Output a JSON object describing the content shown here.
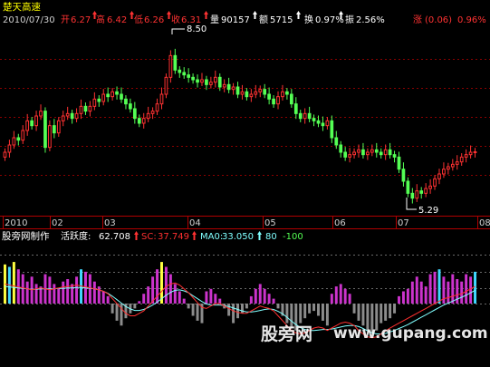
{
  "colors": {
    "background": "#000000",
    "up": "#ff3232",
    "down": "#00e1e1",
    "candle_up": "#ff3232",
    "candle_down": "#54ff54",
    "grid": "#8b0000",
    "axis_text": "#d0d0d0",
    "title": "#ffff00",
    "indicator_up": "#cc33cc",
    "indicator_down": "#8c8c8c",
    "signal_yellow": "#ffff40",
    "signal_cyan": "#40d8ff",
    "sc_line": "#ff3030",
    "ma_line": "#80ffff",
    "ref_line": "#ffffff"
  },
  "header": {
    "stock_name": "楚天高速",
    "date": "2010/07/30",
    "open_label": "开",
    "open_value": "6.27",
    "high_label": "高",
    "high_value": "6.42",
    "low_label": "低",
    "low_value": "6.26",
    "close_label": "收",
    "close_value": "6.31",
    "volume_label": "量",
    "volume_value": "90157",
    "amount_label": "额",
    "amount_value": "5715",
    "turnover_label": "换",
    "turnover_value": "0.97%",
    "amplitude_label": "振",
    "amplitude_value": "2.56%",
    "change_label": "涨",
    "change_value": "(0.06)",
    "change_pct": "0.96%"
  },
  "indicator": {
    "name": "股旁网制作",
    "activity_label": "活跃度:",
    "activity_value": "62.708",
    "sc_label": "SC:",
    "sc_value": "37.749",
    "ma_label": "MA0:",
    "ma_value": "33.050",
    "level_high": "80",
    "level_low": "-100"
  },
  "watermark": {
    "cn": "股旁网",
    "url": "www.gupang.com"
  },
  "chart_data": [
    {
      "type": "candlestick",
      "title": "楚天高速",
      "x_tick_labels": [
        "2010",
        "02",
        "03",
        "04",
        "05",
        "06",
        "07",
        "08"
      ],
      "annotations": [
        {
          "label": "8.50",
          "value": 8.5,
          "note": "period high"
        },
        {
          "label": "5.29",
          "value": 5.29,
          "note": "period low"
        }
      ],
      "ylim": [
        5.1,
        8.7
      ],
      "closes": [
        6.3,
        6.45,
        6.6,
        6.55,
        6.75,
        6.95,
        6.85,
        7.05,
        7.15,
        6.4,
        6.85,
        6.7,
        6.95,
        7.05,
        7.1,
        7.0,
        7.1,
        7.25,
        7.15,
        7.25,
        7.4,
        7.35,
        7.5,
        7.45,
        7.55,
        7.5,
        7.4,
        7.3,
        7.2,
        7.0,
        6.9,
        7.0,
        7.1,
        7.15,
        7.3,
        7.5,
        7.85,
        8.3,
        8.0,
        7.95,
        7.9,
        7.85,
        7.8,
        7.75,
        7.8,
        7.7,
        7.75,
        7.85,
        7.65,
        7.7,
        7.6,
        7.65,
        7.5,
        7.55,
        7.45,
        7.5,
        7.55,
        7.6,
        7.5,
        7.4,
        7.3,
        7.45,
        7.55,
        7.5,
        7.3,
        7.1,
        7.0,
        7.1,
        7.0,
        6.95,
        6.9,
        6.85,
        6.95,
        6.6,
        6.45,
        6.3,
        6.2,
        6.25,
        6.3,
        6.35,
        6.25,
        6.3,
        6.35,
        6.3,
        6.25,
        6.35,
        6.25,
        6.2,
        5.95,
        5.7,
        5.45,
        5.35,
        5.5,
        5.45,
        5.55,
        5.6,
        5.75,
        5.85,
        5.95,
        6.0,
        6.05,
        6.1,
        6.2,
        6.25,
        6.3,
        6.31
      ]
    },
    {
      "type": "bar",
      "title": "股旁网制作",
      "series": [
        {
          "name": "活跃度",
          "values": [
            80,
            75,
            85,
            70,
            60,
            45,
            55,
            40,
            35,
            60,
            55,
            40,
            30,
            45,
            50,
            40,
            55,
            70,
            65,
            60,
            45,
            35,
            25,
            15,
            -20,
            -35,
            -45,
            -30,
            -20,
            -10,
            5,
            20,
            35,
            55,
            70,
            85,
            75,
            60,
            40,
            25,
            10,
            -10,
            -25,
            -35,
            -40,
            25,
            30,
            20,
            10,
            -10,
            -25,
            -40,
            -30,
            -20,
            -10,
            15,
            30,
            40,
            30,
            20,
            10,
            -10,
            -25,
            -40,
            -50,
            -55,
            -40,
            -30,
            -20,
            -15,
            -25,
            -35,
            -45,
            20,
            35,
            40,
            30,
            20,
            -20,
            -35,
            -45,
            -55,
            -60,
            -55,
            -40,
            -35,
            -30,
            -20,
            15,
            25,
            30,
            45,
            55,
            45,
            35,
            60,
            65,
            70,
            55,
            45,
            60,
            50,
            45,
            60,
            55,
            65
          ]
        },
        {
          "name": "SC",
          "values": [
            40,
            38,
            36,
            34,
            32,
            30,
            28,
            30,
            32,
            30,
            28,
            30,
            32,
            34,
            35,
            36,
            38,
            36,
            34,
            32,
            30,
            28,
            25,
            20,
            10,
            0,
            -10,
            -20,
            -25,
            -25,
            -20,
            -15,
            -5,
            5,
            15,
            25,
            35,
            40,
            42,
            38,
            30,
            22,
            12,
            2,
            -8,
            -10,
            -5,
            0,
            0,
            -5,
            -10,
            -15,
            -18,
            -20,
            -20,
            -15,
            -10,
            -5,
            -8,
            -10,
            -15,
            -25,
            -35,
            -45,
            -55,
            -60,
            -62,
            -60,
            -55,
            -50,
            -48,
            -50,
            -55,
            -50,
            -45,
            -40,
            -38,
            -40,
            -45,
            -55,
            -62,
            -68,
            -70,
            -68,
            -62,
            -56,
            -50,
            -45,
            -40,
            -35,
            -30,
            -25,
            -20,
            -15,
            -10,
            -5,
            0,
            5,
            10,
            12,
            15,
            18,
            20,
            25,
            30,
            35
          ]
        },
        {
          "name": "MA0",
          "values": [
            35,
            34,
            33,
            32,
            31,
            30,
            29,
            29,
            30,
            30,
            30,
            30,
            31,
            31,
            32,
            32,
            33,
            33,
            32,
            31,
            30,
            28,
            25,
            21,
            15,
            8,
            1,
            -6,
            -11,
            -14,
            -14,
            -12,
            -8,
            -3,
            3,
            10,
            17,
            23,
            27,
            28,
            26,
            22,
            16,
            10,
            4,
            -1,
            -3,
            -3,
            -3,
            -4,
            -6,
            -9,
            -12,
            -15,
            -17,
            -17,
            -16,
            -14,
            -12,
            -11,
            -12,
            -16,
            -21,
            -28,
            -36,
            -43,
            -49,
            -53,
            -55,
            -55,
            -54,
            -53,
            -53,
            -52,
            -50,
            -48,
            -46,
            -45,
            -45,
            -47,
            -51,
            -56,
            -60,
            -62,
            -62,
            -61,
            -58,
            -55,
            -51,
            -47,
            -43,
            -38,
            -33,
            -28,
            -23,
            -18,
            -13,
            -8,
            -3,
            1,
            5,
            9,
            13,
            17,
            22,
            27
          ]
        }
      ],
      "ylim": [
        -100,
        100
      ],
      "reference_lines": [
        80,
        -100
      ]
    }
  ]
}
